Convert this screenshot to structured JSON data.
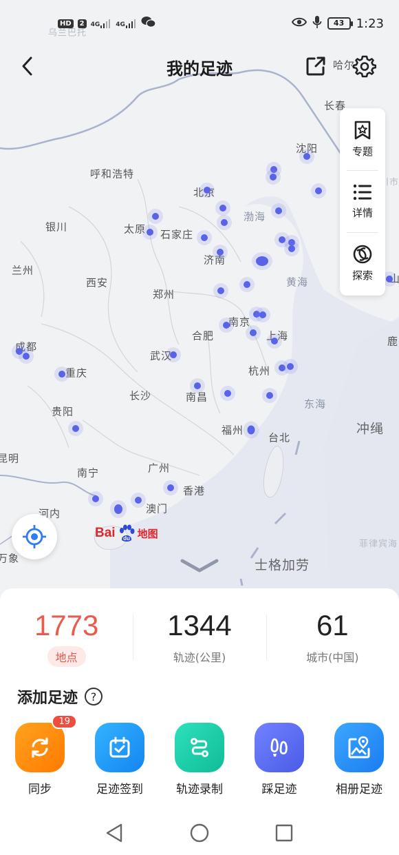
{
  "status_bar": {
    "hd_badge": "HD",
    "sim_badge": "2",
    "signal_1": "4G",
    "signal_2": "4G",
    "battery": "43",
    "time": "1:23"
  },
  "header": {
    "title": "我的足迹"
  },
  "side_panel": {
    "items": [
      {
        "label": "专题",
        "icon": "bookmark-star-icon"
      },
      {
        "label": "详情",
        "icon": "list-icon"
      },
      {
        "label": "探索",
        "icon": "compass-icon"
      }
    ]
  },
  "map": {
    "places": [
      "乌兰巴托",
      "哈尔",
      "长春",
      "沈阳",
      "呼和浩特",
      "北京",
      "银川",
      "太原",
      "石家庄",
      "渤海",
      "兰州",
      "济南",
      "西安",
      "郑州",
      "黄海",
      "南京",
      "合肥",
      "上海",
      "成都",
      "武汉",
      "杭州",
      "重庆",
      "长沙",
      "南昌",
      "东海",
      "贵阳",
      "福州",
      "台北",
      "冲绳",
      "昆明",
      "南宁",
      "广州",
      "香港",
      "澳门",
      "河内",
      "菲律宾海",
      "士格加劳",
      "万象",
      "鹿",
      "川市",
      "山"
    ],
    "logo_text": "Bai",
    "logo_suffix": "地图"
  },
  "stats": [
    {
      "value": "1773",
      "label": "地点"
    },
    {
      "value": "1344",
      "label": "轨迹(公里)"
    },
    {
      "value": "61",
      "label": "城市(中国)"
    }
  ],
  "add_section": {
    "title": "添加足迹",
    "help": "?"
  },
  "actions": [
    {
      "label": "同步",
      "icon": "sync-icon",
      "color": "#ff8a00",
      "badge": "19"
    },
    {
      "label": "足迹签到",
      "icon": "calendar-check-icon",
      "color": "#1e9af5"
    },
    {
      "label": "轨迹录制",
      "icon": "route-icon",
      "color": "#16c9a4"
    },
    {
      "label": "踩足迹",
      "icon": "footprint-icon",
      "color": "#5b6cf0"
    },
    {
      "label": "相册足迹",
      "icon": "photo-map-icon",
      "color": "#1e8ef5"
    }
  ],
  "colors": {
    "accent_red": "#ec5a4d",
    "dot_blue": "#5963e8"
  }
}
